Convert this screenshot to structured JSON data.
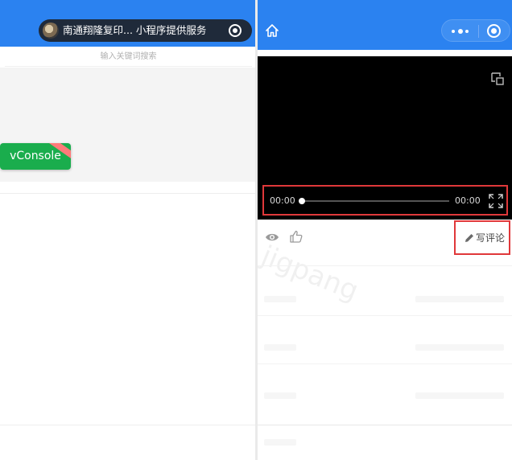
{
  "left_panel": {
    "capsule_title": "南通翔隆复印... 小程序提供服务",
    "search_placeholder": "输入关键词搜索",
    "vconsole_label": "vConsole",
    "colors": {
      "header": "#2b82f0",
      "vconsole": "#1aad4d"
    }
  },
  "right_panel": {
    "video": {
      "current_time": "00:00",
      "total_time": "00:00",
      "progress": 0
    },
    "actions": {
      "comment_label": "写评论"
    },
    "watermark": "jigpang",
    "colors": {
      "header": "#2b82f0",
      "highlight": "#e0383a"
    }
  }
}
